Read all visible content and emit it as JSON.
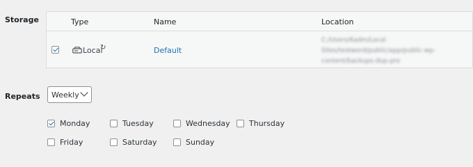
{
  "storage": {
    "label": "Storage",
    "columns": {
      "type": "Type",
      "name": "Name",
      "location": "Location"
    },
    "row": {
      "checked": true,
      "type": "Local",
      "type_icon": "drive-icon",
      "refresh_icon": "refresh-icon",
      "name": "Default",
      "location_lines": [
        "C:/Users/Kadm/Local",
        "Sites/testword/public/app/public-wp-",
        "content/backups-dup-pro"
      ]
    }
  },
  "repeats": {
    "label": "Repeats",
    "selected": "Weekly",
    "days": [
      {
        "label": "Monday",
        "checked": true
      },
      {
        "label": "Tuesday",
        "checked": false
      },
      {
        "label": "Wednesday",
        "checked": false
      },
      {
        "label": "Thursday",
        "checked": false
      },
      {
        "label": "Friday",
        "checked": false
      },
      {
        "label": "Saturday",
        "checked": false
      },
      {
        "label": "Sunday",
        "checked": false
      }
    ]
  },
  "colors": {
    "link": "#2271b1",
    "background": "#f0f0f1",
    "table_background": "#f6f7f7"
  }
}
